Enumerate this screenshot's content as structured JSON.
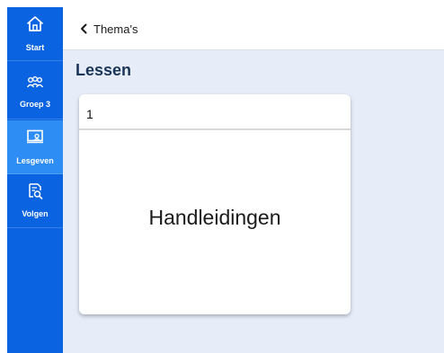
{
  "sidebar": {
    "accent_color": "#0a63e0",
    "active_color": "#2e8df5",
    "items": [
      {
        "label": "Start",
        "icon": "home-icon"
      },
      {
        "label": "Groep 3",
        "icon": "group-icon"
      },
      {
        "label": "Lesgeven",
        "icon": "presentation-board-icon",
        "active": true
      },
      {
        "label": "Volgen",
        "icon": "document-search-icon"
      }
    ]
  },
  "header": {
    "back_label": "Thema's",
    "back_icon": "chevron-left-icon"
  },
  "main": {
    "title": "Lessen",
    "background_color": "#e6edf8",
    "cards": [
      {
        "number": "1",
        "title": "Handleidingen"
      }
    ]
  }
}
